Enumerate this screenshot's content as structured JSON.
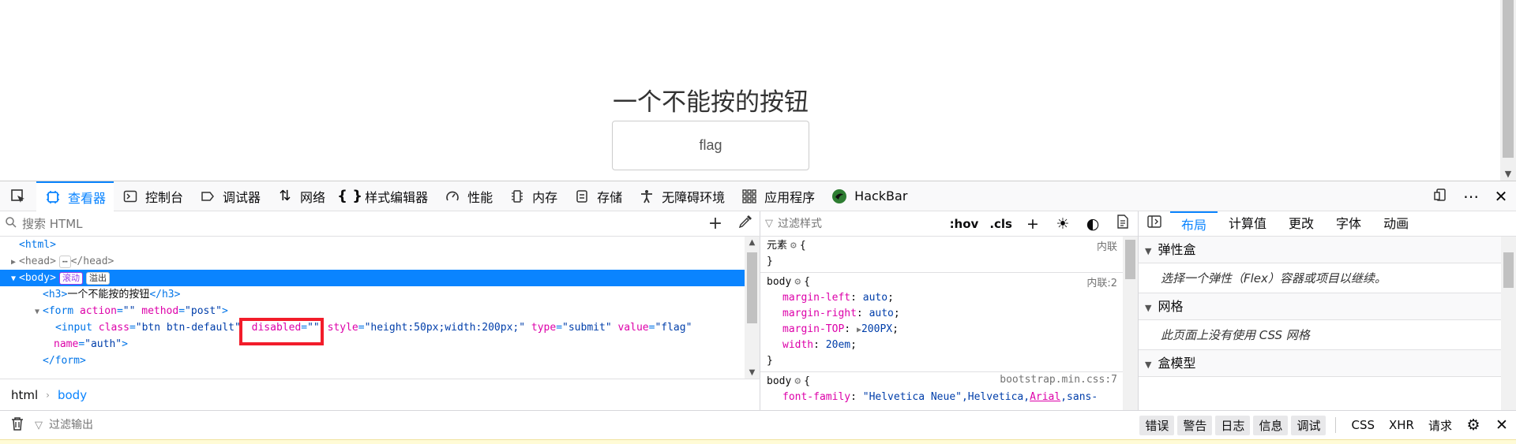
{
  "page": {
    "title": "一个不能按的按钮",
    "button_value": "flag"
  },
  "toolbar": {
    "tabs": [
      {
        "label": "查看器",
        "icon": "inspector-icon"
      },
      {
        "label": "控制台",
        "icon": "console-icon"
      },
      {
        "label": "调试器",
        "icon": "debugger-icon"
      },
      {
        "label": "网络",
        "icon": "network-icon"
      },
      {
        "label": "样式编辑器",
        "icon": "style-editor-icon"
      },
      {
        "label": "性能",
        "icon": "performance-icon"
      },
      {
        "label": "内存",
        "icon": "memory-icon"
      },
      {
        "label": "存储",
        "icon": "storage-icon"
      },
      {
        "label": "无障碍环境",
        "icon": "accessibility-icon"
      },
      {
        "label": "应用程序",
        "icon": "application-icon"
      },
      {
        "label": "HackBar",
        "icon": "hackbar-icon"
      }
    ]
  },
  "markup": {
    "search_placeholder": "搜索 HTML",
    "lines": {
      "html_open": "<html>",
      "head": "<head>",
      "head_close": "</head>",
      "head_ellipsis": "⋯",
      "body": "<body>",
      "body_badge_1": "滚动",
      "body_badge_2": "溢出",
      "h3_open": "<h3>",
      "h3_text": "一个不能按的按钮",
      "h3_close": "</h3>",
      "form_tag": "<form",
      "form_attr_action": "action",
      "form_val_action": "\"\"",
      "form_attr_method": "method",
      "form_val_method": "\"post\"",
      "form_end": ">",
      "input_tag": "<input",
      "input_attr_class": "class",
      "input_val_class": "\"btn btn-default\"",
      "input_attr_disabled": "disabled",
      "input_val_disabled": "\"\"",
      "input_attr_style": "style",
      "input_val_style": "\"height:50px;width:200px;\"",
      "input_attr_type": "type",
      "input_val_type": "\"submit\"",
      "input_attr_value": "value",
      "input_val_value": "\"flag\"",
      "input_attr_name": "name",
      "input_val_name": "\"auth\"",
      "input_end": ">",
      "form_close": "</form>"
    },
    "breadcrumb": [
      "html",
      "body"
    ]
  },
  "rules": {
    "filter_placeholder": "过滤样式",
    "hov": ":hov",
    "cls": ".cls",
    "element_rule": {
      "selector": "元素",
      "source": "内联"
    },
    "body_inline": {
      "selector": "body",
      "source": "内联:2",
      "decls": [
        {
          "name": "margin-left",
          "value": "auto"
        },
        {
          "name": "margin-right",
          "value": "auto"
        },
        {
          "name": "margin-TOP",
          "value": "200PX"
        },
        {
          "name": "width",
          "value": "20em"
        }
      ]
    },
    "body_bootstrap": {
      "selector": "body",
      "source": "bootstrap.min.css:7",
      "decl_name": "font-family",
      "decl_value_1": "\"Helvetica Neue\",Helvetica,",
      "decl_value_link": "Arial",
      "decl_value_2": ",sans-"
    }
  },
  "layout_panel": {
    "tabs": [
      "布局",
      "计算值",
      "更改",
      "字体",
      "动画"
    ],
    "sections": [
      {
        "title": "弹性盒",
        "body": "选择一个弹性（Flex）容器或项目以继续。"
      },
      {
        "title": "网格",
        "body": "此页面上没有使用 CSS 网格"
      },
      {
        "title": "盒模型",
        "body": ""
      }
    ]
  },
  "console": {
    "filter_placeholder": "过滤输出",
    "levels": [
      "错误",
      "警告",
      "日志",
      "信息",
      "调试"
    ],
    "categories": [
      "CSS",
      "XHR",
      "请求"
    ]
  },
  "colors": {
    "accent": "#0a84ff",
    "highlight_box": "#f21c2a"
  }
}
